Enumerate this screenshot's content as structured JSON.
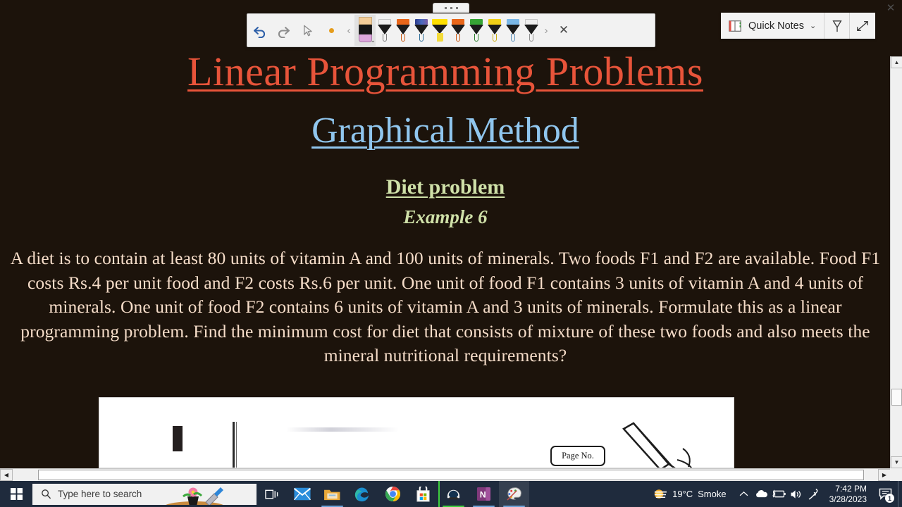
{
  "window": {
    "close_label": "✕",
    "drag_handle_icon": "three-dots-drag-handle"
  },
  "ink_toolbar": {
    "undo_icon": "undo-arrow-icon",
    "redo_icon": "redo-arrow-icon",
    "select_icon": "lasso-select-cursor-icon",
    "touch_write_icon": "ink-dot-icon",
    "prev_chevron": "‹",
    "next_chevron": "›",
    "close_label": "✕",
    "selected_tool": {
      "name": "color-well-eraser-tool",
      "swatch_top": "#f3cd99",
      "swatch_mid": "#151515",
      "swatch_bottom": "#dca7dc",
      "chevron": "⌄"
    },
    "pens": [
      {
        "name": "pen-white",
        "type": "pen",
        "cap": "#f0f0f0",
        "tip": "#7a7a7a"
      },
      {
        "name": "pen-orange",
        "type": "pen",
        "cap": "#e8661a",
        "tip": "#c8560f"
      },
      {
        "name": "pen-galaxy",
        "type": "pen",
        "cap": "#3a4a9a",
        "tip": "#2f6f9a"
      },
      {
        "name": "highlighter-yellow",
        "type": "highlighter",
        "cap": "#ffe000",
        "tip": "#f2da3a"
      },
      {
        "name": "pen-orange-2",
        "type": "pen",
        "cap": "#e8661a",
        "tip": "#c8560f"
      },
      {
        "name": "pen-green",
        "type": "pen",
        "cap": "#36a536",
        "tip": "#2b7f2b"
      },
      {
        "name": "pen-yellow",
        "type": "pen",
        "cap": "#f0d017",
        "tip": "#c9ab12"
      },
      {
        "name": "pen-lightblue",
        "type": "pen",
        "cap": "#7ab8e8",
        "tip": "#5a90bb"
      },
      {
        "name": "pen-silver",
        "type": "pen",
        "cap": "#eeeeee",
        "tip": "#8f8f8f"
      }
    ]
  },
  "quick_bar": {
    "notebook_icon": "notebook-icon",
    "notebook_label": "Quick Notes",
    "dropdown_chevron": "⌄",
    "highlighter_icon": "highlighter-pen-icon",
    "expand_icon": "expand-diagonal-arrows-icon"
  },
  "document": {
    "title": "Linear Programming Problems",
    "subtitle": "Graphical Method",
    "section_heading": "Diet problem",
    "example_label": "Example 6",
    "body": "A diet is to contain at least 80 units of vitamin A and 100 units of minerals. Two foods F1 and F2 are available. Food F1 costs Rs.4 per unit food and F2 costs Rs.6 per unit. One unit of food F1 contains 3 units of vitamin A and 4 units of minerals. One unit of food F2 contains 6 units of vitamin A and 3 units of minerals. Formulate this as a linear programming problem. Find the minimum cost for diet that consists of mixture of these two foods and also meets the mineral nutritional requirements?",
    "photo": {
      "name": "notebook-page-photo",
      "page_no_label": "Page No."
    },
    "colors": {
      "background": "#1c130b",
      "title": "#e8543a",
      "subtitle": "#90c6ee",
      "heading": "#cfe0a8",
      "body": "#f6ddc9"
    }
  },
  "scrollbars": {
    "vertical": {
      "up_arrow": "▲",
      "down_arrow": "▼"
    },
    "horizontal": {
      "left_arrow": "◀",
      "right_arrow": "▶"
    }
  },
  "taskbar": {
    "start_icon": "windows-start-icon",
    "search": {
      "icon": "search-icon",
      "placeholder": "Type here to search",
      "decoration_icon": "flower-pot-trowel-illustration"
    },
    "task_view_icon": "task-view-icon",
    "apps": [
      {
        "name": "taskbar-mail",
        "icon": "mail-envelope-icon",
        "state": "idle"
      },
      {
        "name": "taskbar-file-explorer",
        "icon": "folder-icon",
        "state": "open"
      },
      {
        "name": "taskbar-edge",
        "icon": "edge-browser-icon",
        "state": "open"
      },
      {
        "name": "taskbar-chrome",
        "icon": "chrome-browser-icon",
        "state": "idle"
      },
      {
        "name": "taskbar-microsoft-store",
        "icon": "microsoft-store-icon",
        "state": "idle"
      },
      {
        "name": "taskbar-game-helmet",
        "icon": "helmet-app-icon",
        "state": "running"
      },
      {
        "name": "taskbar-onenote",
        "icon": "onenote-icon",
        "state": "open"
      },
      {
        "name": "taskbar-paint",
        "icon": "paint-palette-icon",
        "state": "active"
      }
    ],
    "tray": {
      "weather_icon": "hazy-sun-icon",
      "temperature": "19°C",
      "condition": "Smoke",
      "chevron_up": "⌃",
      "onedrive_icon": "onedrive-cloud-icon",
      "battery_icon": "battery-charging-icon",
      "volume_icon": "speaker-volume-icon",
      "pen_icon": "windows-ink-pen-icon",
      "time": "7:42 PM",
      "date": "3/28/2023",
      "notification_icon": "notification-chat-icon",
      "notification_count": "1"
    }
  }
}
